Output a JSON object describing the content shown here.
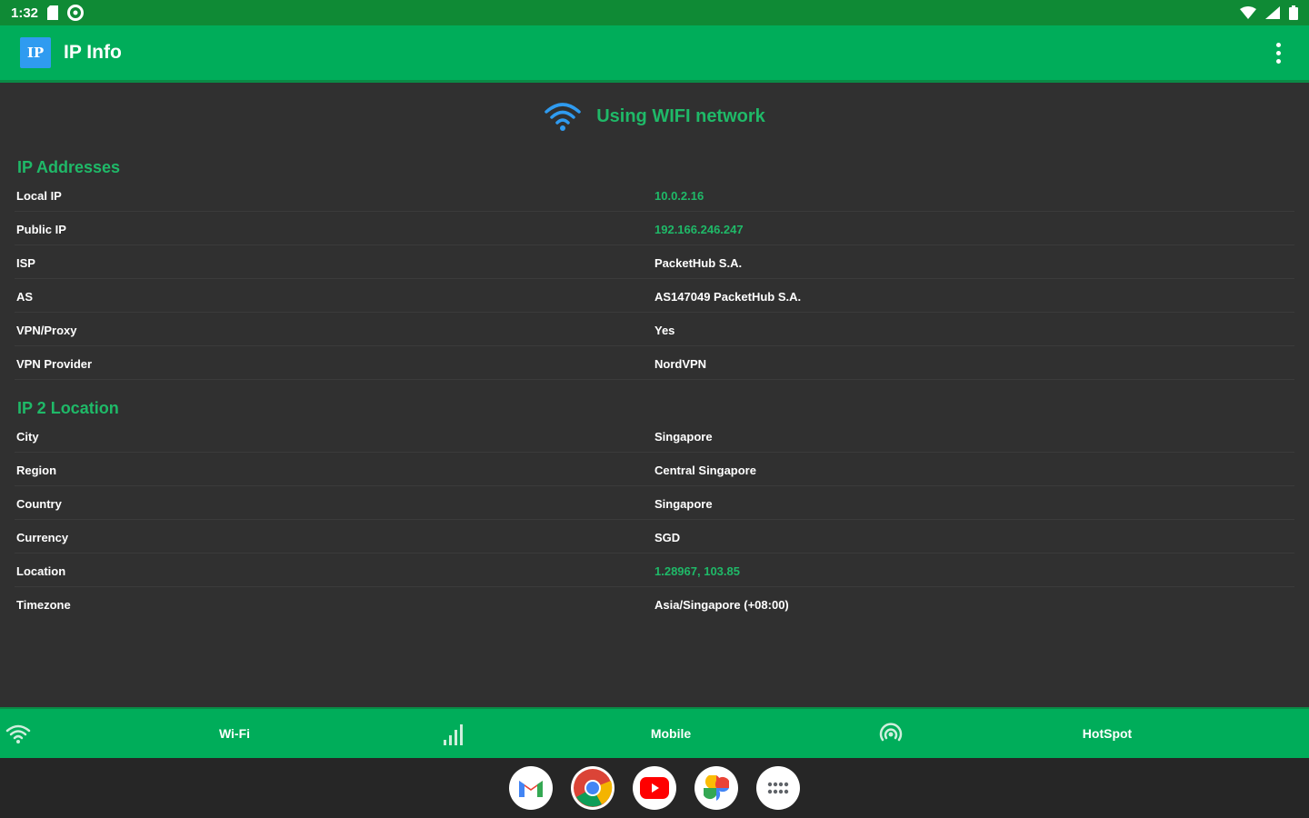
{
  "status_bar": {
    "time": "1:32"
  },
  "app_bar": {
    "logo_text": "IP",
    "title": "IP Info"
  },
  "banner": {
    "text": "Using WIFI network"
  },
  "sections": [
    {
      "title": "IP Addresses",
      "rows": [
        {
          "label": "Local IP",
          "value": "10.0.2.16",
          "highlight": true
        },
        {
          "label": "Public IP",
          "value": "192.166.246.247",
          "highlight": true
        },
        {
          "label": "ISP",
          "value": "PacketHub S.A.",
          "highlight": false
        },
        {
          "label": "AS",
          "value": "AS147049 PacketHub S.A.",
          "highlight": false
        },
        {
          "label": "VPN/Proxy",
          "value": "Yes",
          "highlight": false
        },
        {
          "label": "VPN Provider",
          "value": "NordVPN",
          "highlight": false
        }
      ]
    },
    {
      "title": "IP 2 Location",
      "rows": [
        {
          "label": "City",
          "value": "Singapore",
          "highlight": false
        },
        {
          "label": "Region",
          "value": "Central Singapore",
          "highlight": false
        },
        {
          "label": "Country",
          "value": "Singapore",
          "highlight": false
        },
        {
          "label": "Currency",
          "value": "SGD",
          "highlight": false
        },
        {
          "label": "Location",
          "value": "1.28967, 103.85",
          "highlight": true
        },
        {
          "label": "Timezone",
          "value": "Asia/Singapore (+08:00)",
          "highlight": false
        }
      ]
    }
  ],
  "bottom_nav": [
    {
      "label": "Wi-Fi",
      "icon": "wifi-icon"
    },
    {
      "label": "Mobile",
      "icon": "signal-icon"
    },
    {
      "label": "HotSpot",
      "icon": "hotspot-icon"
    }
  ],
  "dock": [
    {
      "icon": "gmail-icon"
    },
    {
      "icon": "chrome-icon"
    },
    {
      "icon": "youtube-icon"
    },
    {
      "icon": "photos-icon"
    },
    {
      "icon": "app-drawer-icon"
    }
  ],
  "colors": {
    "app_bar": "#00ad5a",
    "status_bar": "#0f8a35",
    "accent_green": "#1fb968",
    "background": "#303030",
    "wifi_blue": "#2f9bf0"
  }
}
